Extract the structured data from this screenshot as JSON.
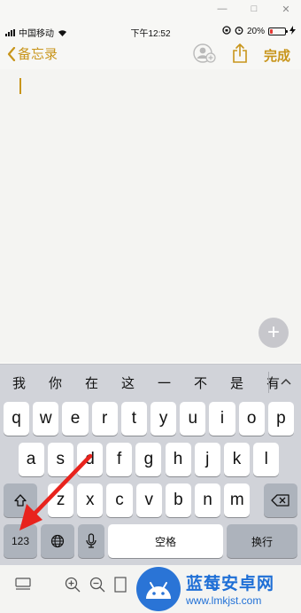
{
  "status_bar": {
    "carrier": "中国移动",
    "time": "下午12:52",
    "battery_percent": "20%",
    "battery_level": 0.2,
    "icons": [
      "signal-icon",
      "wifi-icon",
      "lock-rotation-icon",
      "alarm-icon",
      "battery-icon",
      "charging-icon"
    ]
  },
  "nav": {
    "back_label": "备忘录",
    "done_label": "完成",
    "icons": [
      "share-collaborator-icon",
      "share-icon"
    ],
    "accent_color": "#c8951b"
  },
  "editor": {
    "content": "",
    "fab_label": "+"
  },
  "keyboard": {
    "candidates": [
      "我",
      "你",
      "在",
      "这",
      "一",
      "不",
      "是",
      "有"
    ],
    "row1": [
      "q",
      "w",
      "e",
      "r",
      "t",
      "y",
      "u",
      "i",
      "o",
      "p"
    ],
    "row2": [
      "a",
      "s",
      "d",
      "f",
      "g",
      "h",
      "j",
      "k",
      "l"
    ],
    "row3": [
      "z",
      "x",
      "c",
      "v",
      "b",
      "n",
      "m"
    ],
    "numbers_label": "123",
    "space_label": "空格",
    "return_label": "换行"
  },
  "toolbar": {
    "icons": [
      "checklist-icon",
      "zoom-in-icon",
      "zoom-out-icon",
      "text-format-icon"
    ]
  },
  "watermark": {
    "title": "蓝莓安卓网",
    "url": "www.lmkjst.com"
  },
  "annotation": {
    "color": "#e8231d",
    "points_to": "numbers-key"
  }
}
